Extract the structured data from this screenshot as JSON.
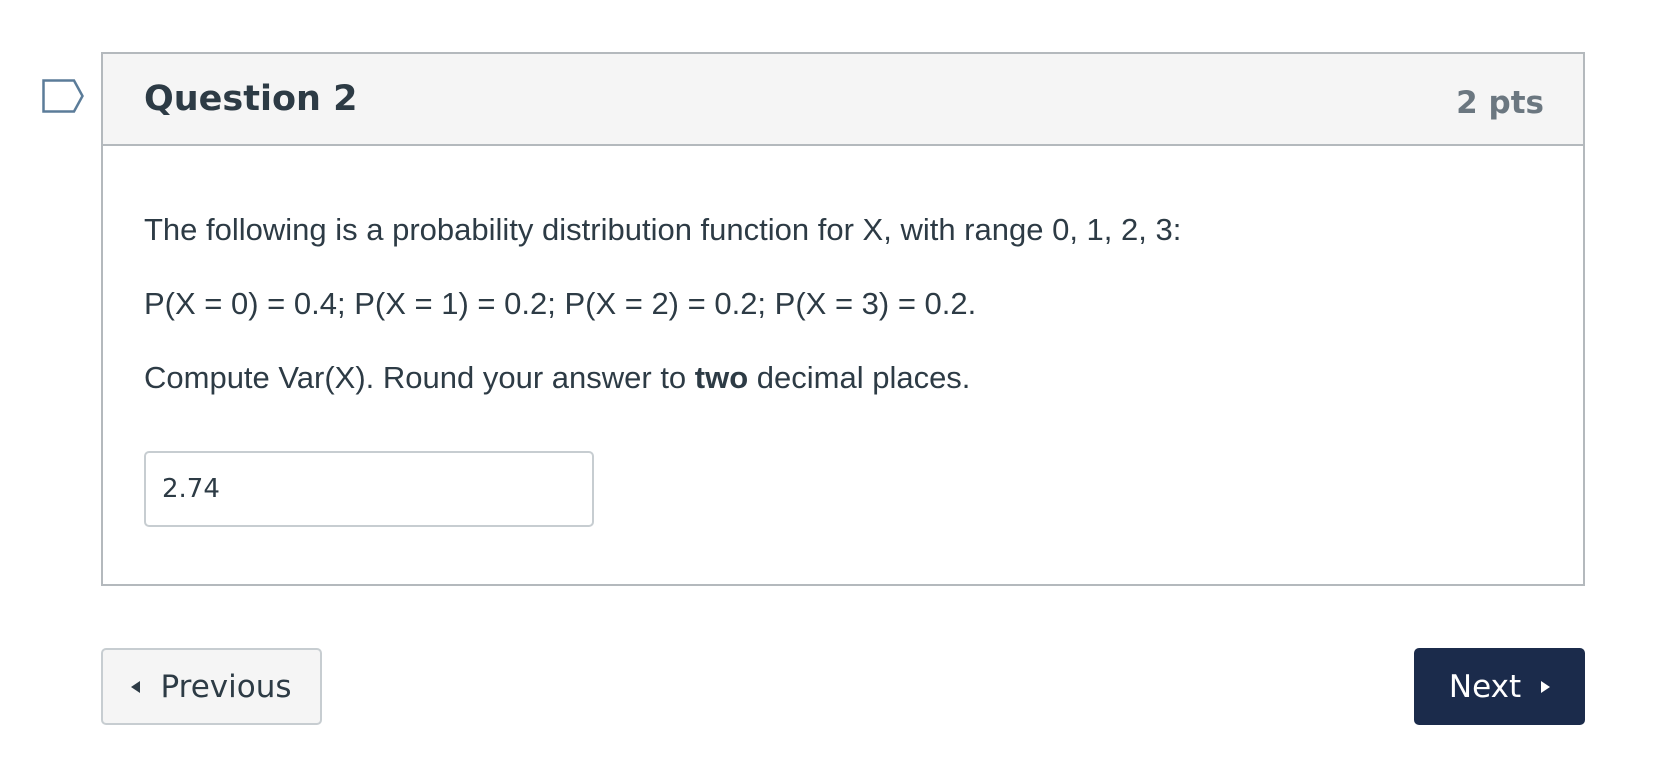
{
  "question": {
    "title": "Question 2",
    "points": "2 pts",
    "text_line1": "The following is a probability distribution function for X, with range 0, 1, 2, 3:",
    "text_line2": "P(X = 0) = 0.4; P(X = 1) = 0.2; P(X = 2) = 0.2; P(X = 3) = 0.2.",
    "text_line3_before": "Compute Var(X). Round your answer to ",
    "text_line3_bold": "two",
    "text_line3_after": " decimal places.",
    "answer_value": "2.74"
  },
  "navigation": {
    "previous_label": "Previous",
    "next_label": "Next"
  },
  "icons": {
    "flag": "flag-icon",
    "previous": "caret-left-icon",
    "next": "caret-right-icon"
  },
  "colors": {
    "next_button_bg": "#1b2b4b",
    "header_bg": "#f5f5f5",
    "border": "#b4b9bd",
    "text": "#2d3b45",
    "points_text": "#6b7780"
  }
}
